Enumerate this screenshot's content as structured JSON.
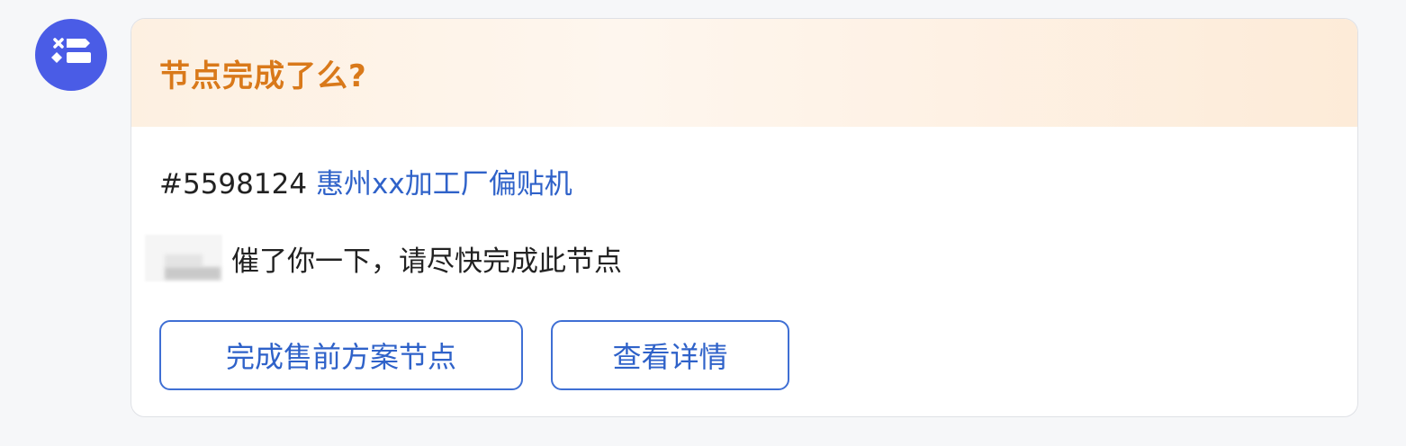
{
  "bot": {
    "avatar_icon": "task-list-icon",
    "avatar_color": "#4a5ce6"
  },
  "card": {
    "title": "节点完成了么?",
    "title_color": "#d9791a",
    "ref_id": "#5598124",
    "ref_name": "惠州xx加工厂偏贴机",
    "link_color": "#2f62c9",
    "mention_text": "催了你一下，请尽快完成此节点",
    "buttons": {
      "complete_label": "完成售前方案节点",
      "detail_label": "查看详情"
    }
  }
}
